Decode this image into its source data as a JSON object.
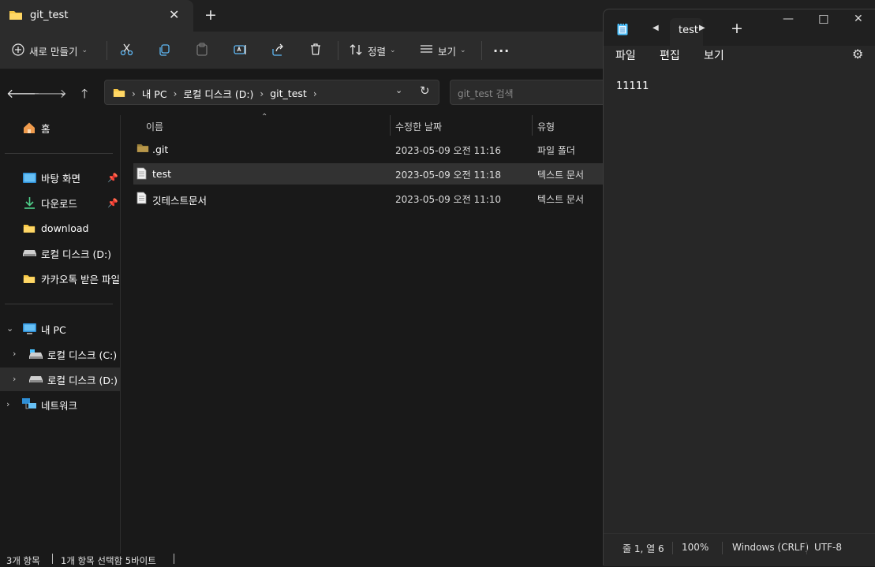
{
  "explorer": {
    "tab": {
      "title": "git_test"
    },
    "toolbar": {
      "new_label": "새로 만들기",
      "sort_label": "정렬",
      "view_label": "보기",
      "more_label": "···"
    },
    "address": {
      "crumbs": [
        "내 PC",
        "로컬 디스크 (D:)",
        "git_test"
      ]
    },
    "search": {
      "placeholder": "git_test 검색"
    },
    "sidebar": {
      "home": "홈",
      "quick": [
        {
          "label": "바탕 화면",
          "pinned": true
        },
        {
          "label": "다운로드",
          "pinned": true
        },
        {
          "label": "download",
          "pinned": false
        },
        {
          "label": "로컬 디스크 (D:)",
          "pinned": false
        },
        {
          "label": "카카오톡 받은 파일",
          "pinned": false
        }
      ],
      "this_pc": "내 PC",
      "drives": [
        {
          "label": "로컬 디스크 (C:)"
        },
        {
          "label": "로컬 디스크 (D:)"
        }
      ],
      "network": "네트워크"
    },
    "columns": {
      "name": "이름",
      "date": "수정한 날짜",
      "type": "유형"
    },
    "files": [
      {
        "name": ".git",
        "date": "2023-05-09 오전 11:16",
        "type": "파일 폴더",
        "kind": "folder",
        "selected": false
      },
      {
        "name": "test",
        "date": "2023-05-09 오전 11:18",
        "type": "텍스트 문서",
        "kind": "text",
        "selected": true
      },
      {
        "name": "깃테스트문서",
        "date": "2023-05-09 오전 11:10",
        "type": "텍스트 문서",
        "kind": "text",
        "selected": false
      }
    ],
    "status": {
      "count": "3개 항목",
      "selection": "1개 항목 선택함 5바이트"
    }
  },
  "notepad": {
    "tab_title": "test",
    "menu": {
      "file": "파일",
      "edit": "편집",
      "view": "보기"
    },
    "content": "11111",
    "status": {
      "position": "줄 1, 열 6",
      "zoom": "100%",
      "line_ending": "Windows (CRLF)",
      "encoding": "UTF-8"
    }
  },
  "colors": {
    "background": "#191919",
    "panel": "#2c2c2c",
    "folder": "#f7c744",
    "accent": "#4cc2ff"
  }
}
